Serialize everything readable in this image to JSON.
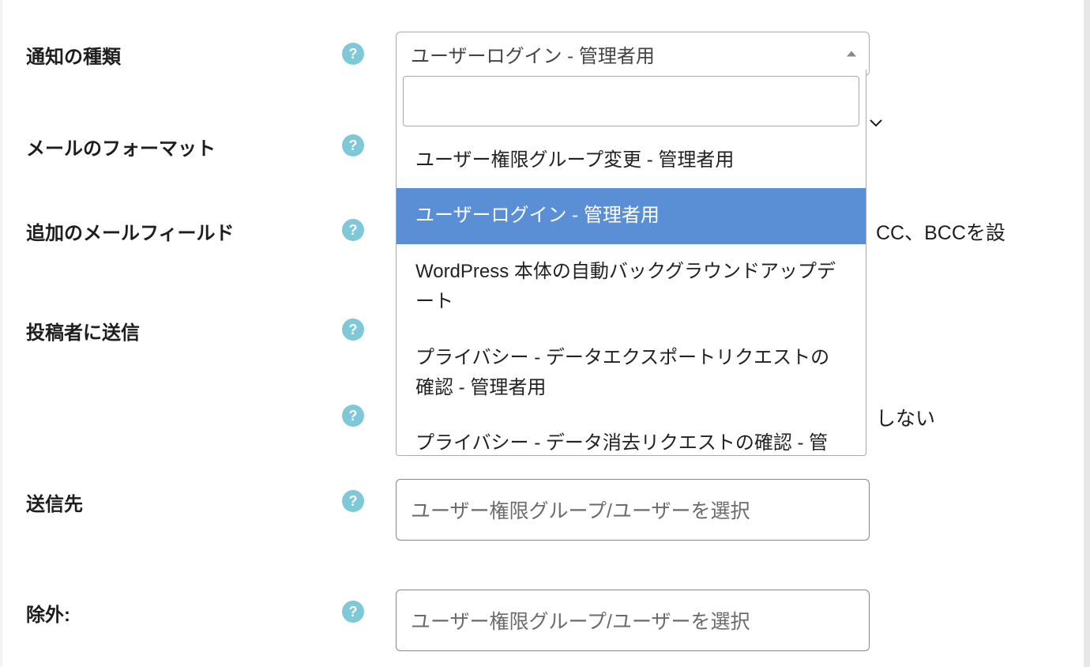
{
  "form": {
    "notification_type": {
      "label": "通知の種類",
      "selected": "ユーザーログイン - 管理者用",
      "options": [
        "ユーザー権限グループ変更 - 管理者用",
        "ユーザーログイン - 管理者用",
        "WordPress 本体の自動バックグラウンドアップデート",
        "プライバシー - データエクスポートリクエストの確認 - 管理者用",
        "プライバシー - データ消去リクエストの確認 - 管理者用"
      ]
    },
    "mail_format": {
      "label": "メールのフォーマット"
    },
    "additional_fields": {
      "label": "追加のメールフィールド",
      "side_text": "CC、BCCを設"
    },
    "send_to_author": {
      "label": "投稿者に送信"
    },
    "blank_setting": {
      "side_text": "しない"
    },
    "destination": {
      "label": "送信先",
      "placeholder": "ユーザー権限グループ/ユーザーを選択"
    },
    "exclude": {
      "label": "除外:",
      "placeholder": "ユーザー権限グループ/ユーザーを選択"
    }
  }
}
